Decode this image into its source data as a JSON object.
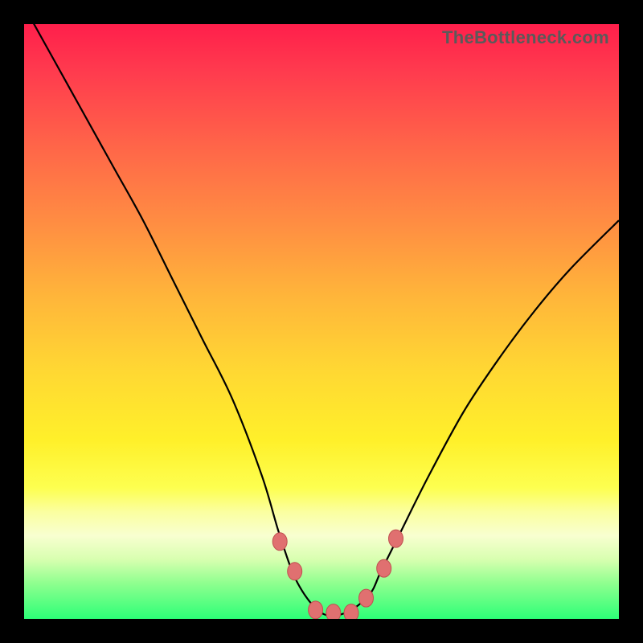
{
  "watermark": "TheBottleneck.com",
  "chart_data": {
    "type": "line",
    "title": "",
    "xlabel": "",
    "ylabel": "",
    "xlim": [
      0,
      1
    ],
    "ylim": [
      0,
      1
    ],
    "curve": {
      "x": [
        0.0,
        0.05,
        0.1,
        0.15,
        0.2,
        0.25,
        0.3,
        0.35,
        0.4,
        0.43,
        0.46,
        0.5,
        0.54,
        0.58,
        0.6,
        0.63,
        0.68,
        0.74,
        0.8,
        0.86,
        0.92,
        1.0
      ],
      "y": [
        1.03,
        0.94,
        0.85,
        0.76,
        0.67,
        0.57,
        0.47,
        0.37,
        0.24,
        0.14,
        0.06,
        0.01,
        0.01,
        0.04,
        0.08,
        0.14,
        0.24,
        0.35,
        0.44,
        0.52,
        0.59,
        0.67
      ]
    },
    "markers": {
      "x": [
        0.43,
        0.455,
        0.49,
        0.52,
        0.55,
        0.575,
        0.605,
        0.625
      ],
      "y": [
        0.13,
        0.08,
        0.015,
        0.01,
        0.01,
        0.035,
        0.085,
        0.135
      ]
    },
    "colors": {
      "curve_stroke": "#000000",
      "marker_fill": "#e07070",
      "marker_stroke": "#c05050"
    }
  }
}
